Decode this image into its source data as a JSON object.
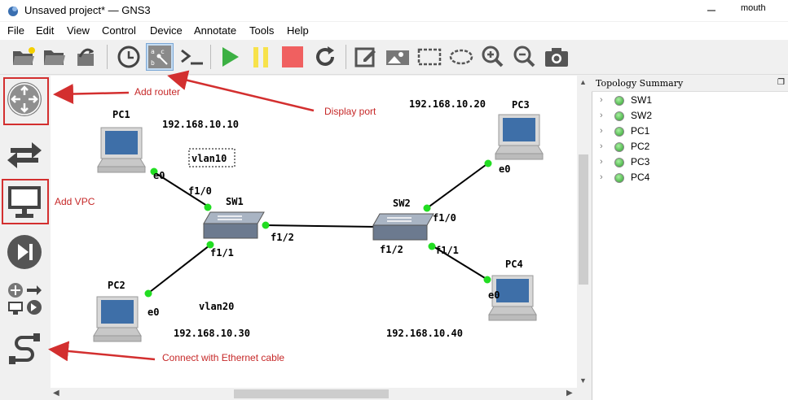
{
  "window": {
    "title": "Unsaved project* — GNS3",
    "user": "mouth"
  },
  "menu": [
    "File",
    "Edit",
    "View",
    "Control",
    "Device",
    "Annotate",
    "Tools",
    "Help"
  ],
  "toolbar_icons": [
    "open-folder-icon",
    "folder-icon",
    "snapshot-icon",
    "clock-icon",
    "display-port-icon",
    "console-icon",
    "play-icon",
    "pause-icon",
    "stop-icon",
    "reload-icon",
    "note-icon",
    "image-icon",
    "rectangle-icon",
    "ellipse-icon",
    "zoom-in-icon",
    "zoom-out-icon",
    "camera-icon"
  ],
  "device_icons": [
    "router-icon",
    "switch-icon",
    "vpc-icon",
    "skip-icon",
    "all-devices-icon",
    "link-cable-icon"
  ],
  "topology": {
    "title": "Topology Summary",
    "items": [
      {
        "label": "SW1",
        "status": "running"
      },
      {
        "label": "SW2",
        "status": "running"
      },
      {
        "label": "PC1",
        "status": "running"
      },
      {
        "label": "PC2",
        "status": "running"
      },
      {
        "label": "PC3",
        "status": "running"
      },
      {
        "label": "PC4",
        "status": "running"
      }
    ]
  },
  "diagram": {
    "nodes": {
      "pc1": "PC1",
      "pc2": "PC2",
      "pc3": "PC3",
      "pc4": "PC4",
      "sw1": "SW1",
      "sw2": "SW2"
    },
    "ips": {
      "pc1": "192.168.10.10",
      "pc2": "192.168.10.30",
      "pc3": "192.168.10.20",
      "pc4": "192.168.10.40"
    },
    "vlans": {
      "v10": "vlan10",
      "v20": "vlan20"
    },
    "ports": {
      "pc1_e0": "e0",
      "sw1_f10": "f1/0",
      "sw1_f11": "f1/1",
      "sw1_f12": "f1/2",
      "pc2_e0": "e0",
      "sw2_f12": "f1/2",
      "sw2_f10": "f1/0",
      "sw2_f11": "f1/1",
      "pc3_e0": "e0",
      "pc4_e0": "e0"
    }
  },
  "annotations": {
    "add_router": "Add router",
    "display_port": "Display port",
    "add_vpc": "Add VPC",
    "connect_cable": "Connect with Ethernet cable"
  },
  "colors": {
    "annotation": "#d32f2f",
    "status_green": "#2ca02c",
    "link": "#000000"
  }
}
